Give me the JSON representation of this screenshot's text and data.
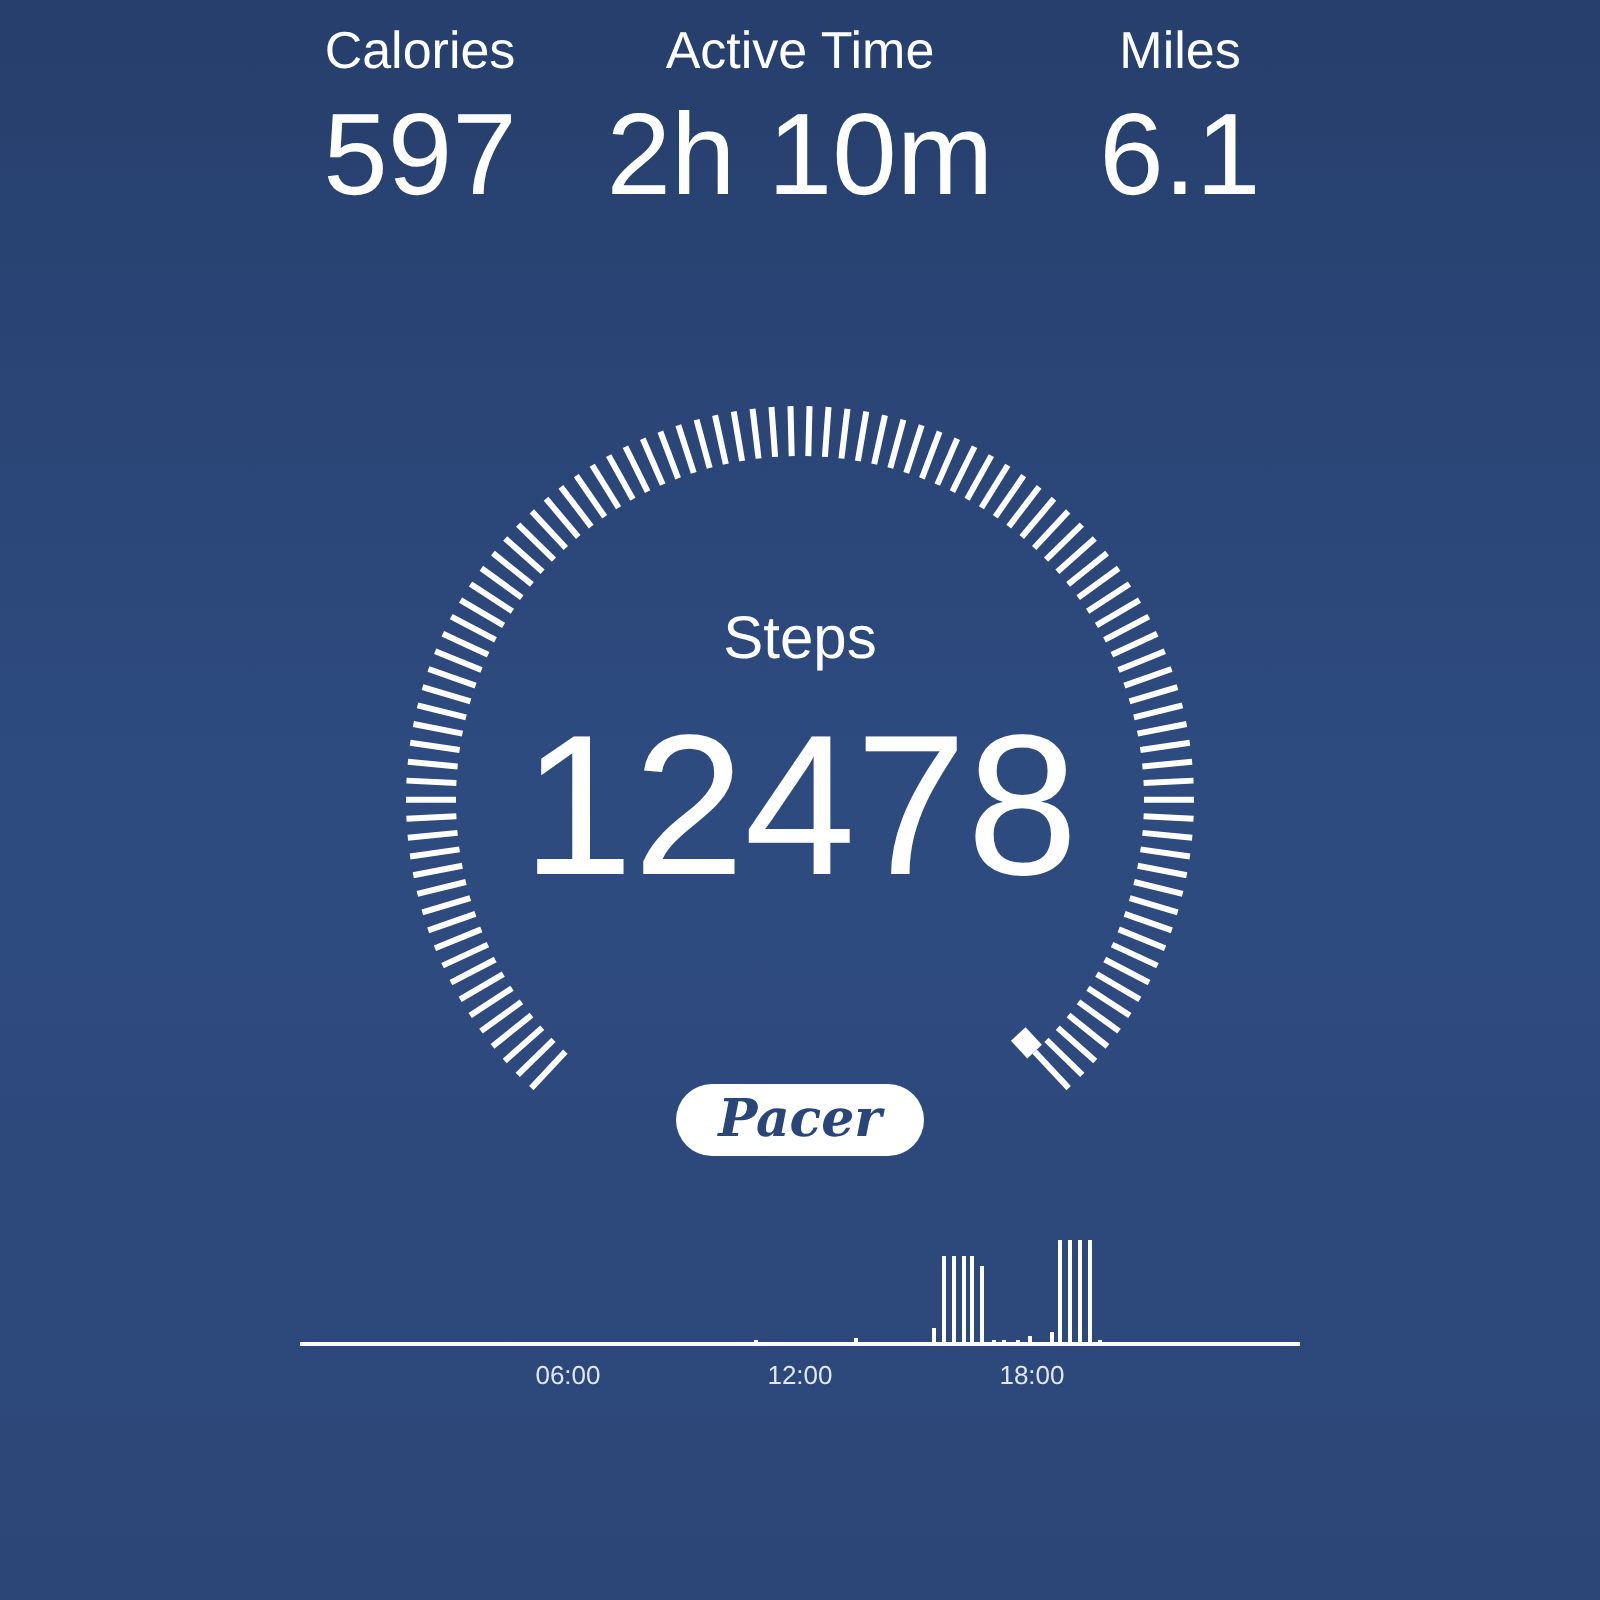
{
  "stats": [
    {
      "label": "Calories",
      "value": "597"
    },
    {
      "label": "Active Time",
      "value": "2h 10m"
    },
    {
      "label": "Miles",
      "value": "6.1"
    }
  ],
  "gauge": {
    "label": "Steps",
    "value": "12478"
  },
  "logo": {
    "text": "Pacer"
  },
  "activity_chart": {
    "ticks": [
      "06:00",
      "12:00",
      "18:00"
    ]
  }
}
